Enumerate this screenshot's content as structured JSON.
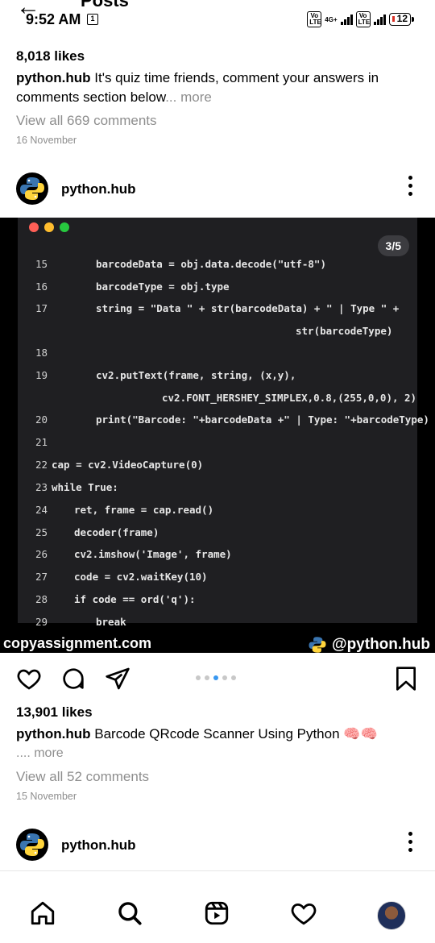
{
  "app": {
    "header_title": "Posts",
    "status": {
      "time": "9:52 AM",
      "sim_indicator": "1",
      "network": "4G+",
      "volte": "Vo LTE",
      "battery": "12"
    }
  },
  "prev_post": {
    "likes": "8,018 likes",
    "username": "python.hub",
    "caption": "It's quiz time friends, comment your answers in comments section below",
    "more": "... more",
    "view_comments": "View all 669 comments",
    "date": "16 November"
  },
  "post": {
    "username": "python.hub",
    "carousel_counter": "3/5",
    "carousel": {
      "total": 5,
      "active": 3
    },
    "window_dot_colors": [
      "#ff5f56",
      "#ffbd2e",
      "#27c93f"
    ],
    "code_lines": [
      {
        "n": "15",
        "t": "barcodeData = obj.data.decode(\"utf-8\")"
      },
      {
        "n": "16",
        "t": "barcodeType = obj.type"
      },
      {
        "n": "17",
        "t": "string = \"Data \" + str(barcodeData) + \" | Type \" +"
      },
      {
        "n": "",
        "t": "str(barcodeType)"
      },
      {
        "n": "18",
        "t": ""
      },
      {
        "n": "19",
        "t": "cv2.putText(frame, string, (x,y),"
      },
      {
        "n": "",
        "t": "cv2.FONT_HERSHEY_SIMPLEX,0.8,(255,0,0), 2)"
      },
      {
        "n": "20",
        "t": "print(\"Barcode: \"+barcodeData +\" | Type: \"+barcodeType)"
      },
      {
        "n": "21",
        "t": ""
      },
      {
        "n": "22",
        "t": "cap = cv2.VideoCapture(0)"
      },
      {
        "n": "23",
        "t": "while True:"
      },
      {
        "n": "24",
        "t": "ret, frame = cap.read()"
      },
      {
        "n": "25",
        "t": "decoder(frame)"
      },
      {
        "n": "26",
        "t": "cv2.imshow('Image', frame)"
      },
      {
        "n": "27",
        "t": "code = cv2.waitKey(10)"
      },
      {
        "n": "28",
        "t": "if code == ord('q'):"
      },
      {
        "n": "29",
        "t": "break"
      }
    ],
    "watermark_left": "copyassignment.com",
    "watermark_right": "@python.hub",
    "likes": "13,901 likes",
    "caption": "Barcode QRcode Scanner Using Python",
    "caption_emoji": "🧠🧠",
    "more": ".... more",
    "view_comments": "View all 52 comments",
    "date": "15 November"
  },
  "next_post": {
    "username": "python.hub"
  },
  "icons": {
    "back": "back-arrow-icon",
    "like": "heart-icon",
    "comment": "comment-bubble-icon",
    "share": "paper-plane-icon",
    "save": "bookmark-icon",
    "more": "more-vertical-icon",
    "nav": [
      "home-icon",
      "search-icon",
      "reels-icon",
      "activity-heart-icon",
      "profile-avatar"
    ]
  },
  "colors": {
    "accent": "#3897f0",
    "muted": "#8e8e8e",
    "editor_bg": "#1f1f22",
    "string": "#f2c38b",
    "keyword": "#c9a4ff"
  }
}
